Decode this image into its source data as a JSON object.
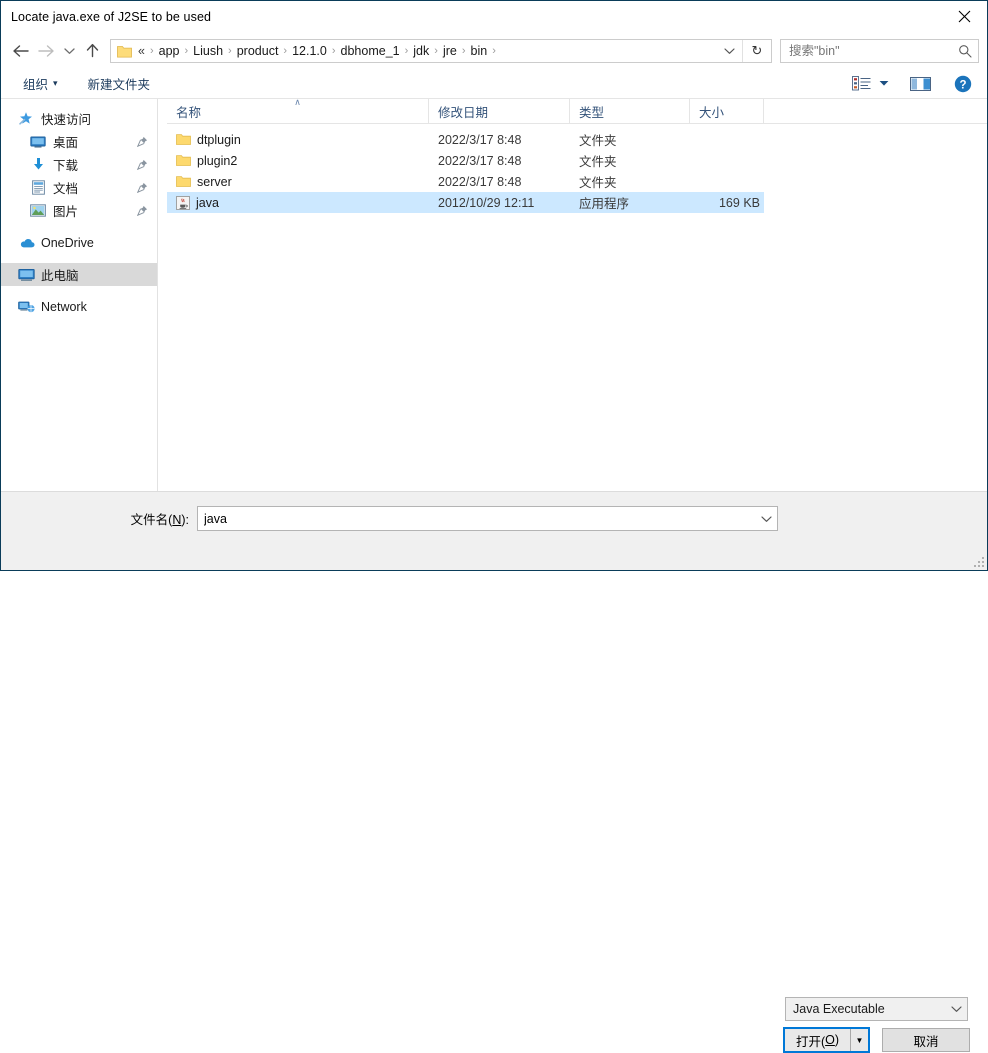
{
  "window": {
    "title": "Locate java.exe of J2SE to be used",
    "close_label": "✕"
  },
  "nav": {
    "back_title": "Back",
    "forward_title": "Forward",
    "recent_title": "Recent locations",
    "up_title": "Up",
    "refresh_label": "↻",
    "breadcrumb_lead": "«",
    "separator": "›",
    "breadcrumb": [
      "app",
      "Liush",
      "product",
      "12.1.0",
      "dbhome_1",
      "jdk",
      "jre",
      "bin"
    ]
  },
  "search": {
    "placeholder": "搜索\"bin\"",
    "value": ""
  },
  "toolbar": {
    "organize_label": "组织",
    "organize_caret": "▾",
    "new_folder_label": "新建文件夹",
    "view_caret": "▾",
    "help_label": "?"
  },
  "sidebar": {
    "items": [
      {
        "label": "快速访问",
        "icon": "quick-access-star-icon",
        "level": 0,
        "pin": false,
        "selected": false
      },
      {
        "label": "桌面",
        "icon": "desktop-icon",
        "level": 1,
        "pin": true,
        "selected": false
      },
      {
        "label": "下载",
        "icon": "downloads-icon",
        "level": 1,
        "pin": true,
        "selected": false
      },
      {
        "label": "文档",
        "icon": "documents-icon",
        "level": 1,
        "pin": true,
        "selected": false
      },
      {
        "label": "图片",
        "icon": "pictures-icon",
        "level": 1,
        "pin": true,
        "selected": false
      },
      {
        "label": "OneDrive",
        "icon": "onedrive-cloud-icon",
        "level": 0,
        "pin": false,
        "selected": false,
        "gap_before": true
      },
      {
        "label": "此电脑",
        "icon": "this-pc-icon",
        "level": 0,
        "pin": false,
        "selected": true,
        "gap_before": true
      },
      {
        "label": "Network",
        "icon": "network-icon",
        "level": 0,
        "pin": false,
        "selected": false,
        "gap_before": true
      }
    ]
  },
  "file_list": {
    "columns": [
      {
        "key": "name",
        "label": "名称",
        "sorted": "asc"
      },
      {
        "key": "date",
        "label": "修改日期",
        "sorted": ""
      },
      {
        "key": "type",
        "label": "类型",
        "sorted": ""
      },
      {
        "key": "size",
        "label": "大小",
        "sorted": ""
      }
    ],
    "sort_caret": "∧",
    "rows": [
      {
        "name": "dtplugin",
        "date": "2022/3/17 8:48",
        "type": "文件夹",
        "size": "",
        "icon": "folder-icon",
        "selected": false
      },
      {
        "name": "plugin2",
        "date": "2022/3/17 8:48",
        "type": "文件夹",
        "size": "",
        "icon": "folder-icon",
        "selected": false
      },
      {
        "name": "server",
        "date": "2022/3/17 8:48",
        "type": "文件夹",
        "size": "",
        "icon": "folder-icon",
        "selected": false
      },
      {
        "name": "java",
        "date": "2012/10/29 12:11",
        "type": "应用程序",
        "size": "169 KB",
        "icon": "java-executable-icon",
        "selected": true
      }
    ]
  },
  "footer": {
    "filename_label_pre": "文件名(",
    "filename_label_key": "N",
    "filename_label_post": "):",
    "filename_value": "java",
    "filetype_value": "Java Executable",
    "open_label_pre": "打开(",
    "open_label_key": "O",
    "open_label_post": ")",
    "open_split_caret": "▼",
    "cancel_label": "取消"
  },
  "colors": {
    "selection_blue": "#cce8ff",
    "sidebar_selection": "#d9d9d9",
    "focus_ring": "#0078d7",
    "header_text": "#34537a",
    "folder_yellow": "#ffd75e",
    "panel_gray": "#f0f0f0"
  }
}
